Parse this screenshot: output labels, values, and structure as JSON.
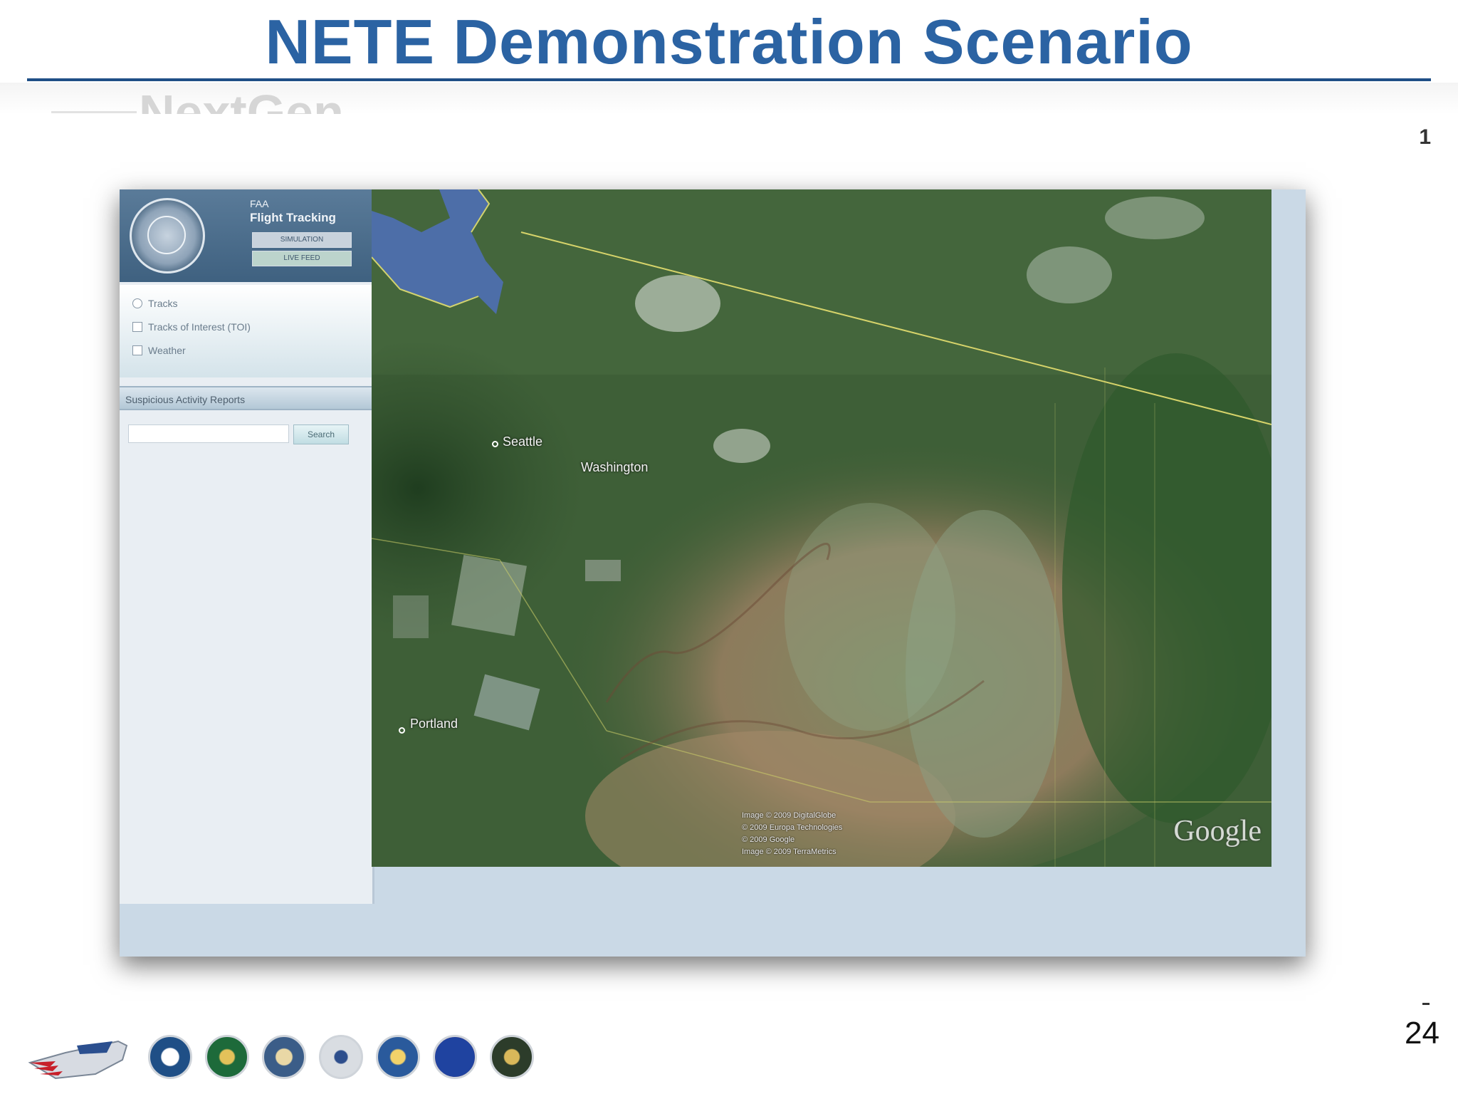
{
  "slide": {
    "title": "NETE Demonstration Scenario",
    "background_text": "NextGen",
    "edge_glyph": "1",
    "page_number": "24"
  },
  "app": {
    "agency_line": "FAA",
    "title": "Flight Tracking",
    "buttons": [
      {
        "label": "SIMULATION"
      },
      {
        "label": "LIVE FEED"
      }
    ],
    "layers": [
      {
        "label": "Tracks",
        "kind": "radio",
        "checked": true
      },
      {
        "label": "Tracks of Interest (TOI)",
        "kind": "checkbox",
        "checked": false
      },
      {
        "label": "Weather",
        "kind": "checkbox",
        "checked": false
      }
    ],
    "panel_title": "Suspicious Activity Reports",
    "search": {
      "value": "",
      "button_label": "Search"
    }
  },
  "map": {
    "cities": [
      {
        "name": "Seattle"
      },
      {
        "name": "Washington"
      },
      {
        "name": "Portland"
      }
    ],
    "attribution": [
      "Image © 2009 DigitalGlobe",
      "© 2009 Europa Technologies",
      "© 2009 Google",
      "Image © 2009 TerraMetrics"
    ],
    "logo": "Google"
  },
  "footer": {
    "logos": [
      {
        "name": "nextgen-shuttle-logo"
      },
      {
        "name": "dot-seal",
        "color": "#1f4f86"
      },
      {
        "name": "faa-seal",
        "color": "#1d6a3a"
      },
      {
        "name": "dod-seal",
        "color": "#3b5d88"
      },
      {
        "name": "dhs-seal",
        "color": "#d9dde2"
      },
      {
        "name": "commerce-seal",
        "color": "#2a5a9c"
      },
      {
        "name": "nasa-logo",
        "color": "#1f43a0"
      },
      {
        "name": "odni-seal",
        "color": "#2c3c2a"
      }
    ]
  }
}
